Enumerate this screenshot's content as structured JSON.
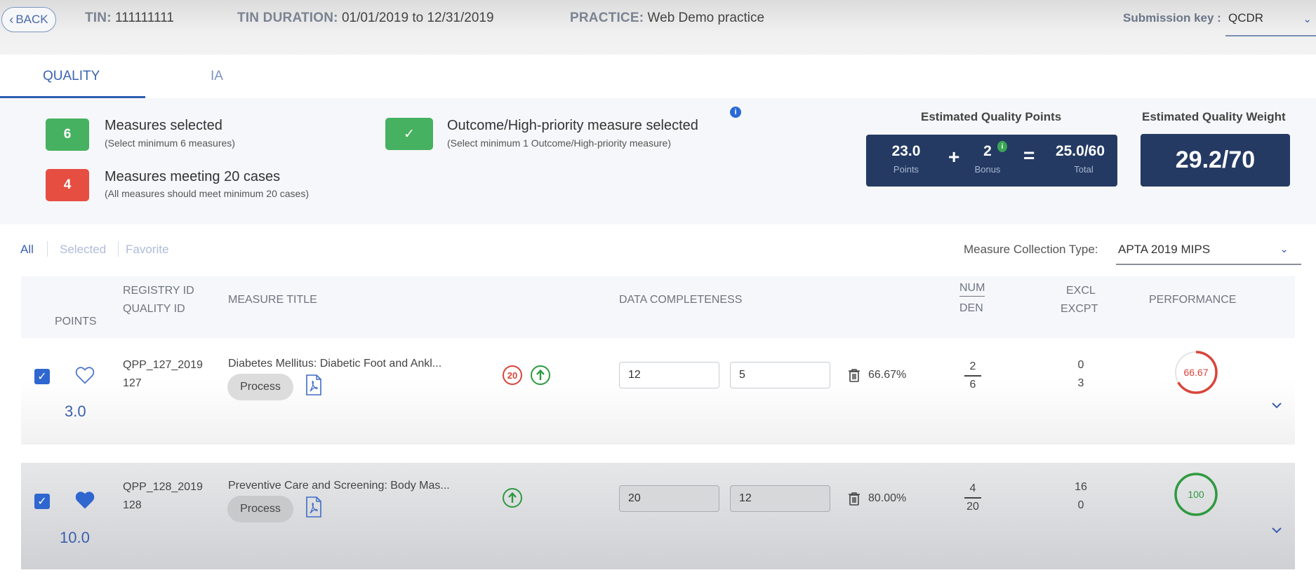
{
  "header": {
    "back_label": "BACK",
    "tin_label": "TIN:",
    "tin_value": "111111111",
    "duration_label": "TIN DURATION:",
    "duration_value": "01/01/2019 to 12/31/2019",
    "practice_label": "PRACTICE:",
    "practice_value": "Web Demo practice",
    "submission_key_label": "Submission key :",
    "submission_key_value": "QCDR"
  },
  "tabs": [
    {
      "label": "QUALITY",
      "active": true
    },
    {
      "label": "IA",
      "active": false
    }
  ],
  "summary": {
    "measures_selected": {
      "count": "6",
      "title": "Measures selected",
      "subtitle": "(Select minimum 6 measures)",
      "color": "#46b160"
    },
    "measures_meeting": {
      "count": "4",
      "title": "Measures meeting 20 cases",
      "subtitle": "(All measures should meet minimum 20 cases)",
      "color": "#e64e42"
    },
    "outcome": {
      "icon": "check-icon",
      "title": "Outcome/High-priority measure selected",
      "subtitle": "(Select minimum 1 Outcome/High-priority measure)"
    },
    "points_label": "Estimated Quality Points",
    "points": {
      "points_value": "23.0",
      "points_caption": "Points",
      "plus": "+",
      "bonus_value": "2",
      "bonus_caption": "Bonus",
      "equals": "=",
      "total_value": "25.0/60",
      "total_caption": "Total"
    },
    "weight_label": "Estimated Quality Weight",
    "weight_value": "29.2/70",
    "navy": "#243a63"
  },
  "filters": [
    {
      "label": "All",
      "active": true
    },
    {
      "label": "Selected",
      "active": false
    },
    {
      "label": "Favorite",
      "active": false
    }
  ],
  "collection": {
    "label": "Measure Collection Type:",
    "value": "APTA 2019 MIPS"
  },
  "table": {
    "headers": {
      "points": "POINTS",
      "registry_id": "REGISTRY ID",
      "quality_id": "QUALITY ID",
      "measure_title": "MEASURE TITLE",
      "data_completeness": "DATA COMPLETENESS",
      "num": "NUM",
      "den": "DEN",
      "excl": "EXCL",
      "excpt": "EXCPT",
      "performance": "PERFORMANCE"
    },
    "rows": [
      {
        "selected": true,
        "favorite": false,
        "points": "3.0",
        "registry_id": "QPP_127_2019",
        "quality_id": "127",
        "title": "Diabetes Mellitus: Diabetic Foot and Ankl...",
        "type": "Process",
        "badges": [
          "20-cases-warning",
          "high-priority"
        ],
        "twenty_label": "20",
        "dc_input_1": "12",
        "dc_input_2": "5",
        "dc_percent": "66.67%",
        "num": "2",
        "den": "6",
        "excl": "0",
        "excpt": "3",
        "performance": "66.67",
        "performance_fraction": 0.6667,
        "performance_color": "#d9443a"
      },
      {
        "selected": true,
        "favorite": true,
        "points": "10.0",
        "registry_id": "QPP_128_2019",
        "quality_id": "128",
        "title": "Preventive Care and Screening: Body Mas...",
        "type": "Process",
        "badges": [
          "high-priority"
        ],
        "dc_input_1": "20",
        "dc_input_2": "12",
        "dc_percent": "80.00%",
        "num": "4",
        "den": "20",
        "excl": "16",
        "excpt": "0",
        "performance": "100",
        "performance_fraction": 1.0,
        "performance_color": "#2e9a40"
      }
    ]
  }
}
